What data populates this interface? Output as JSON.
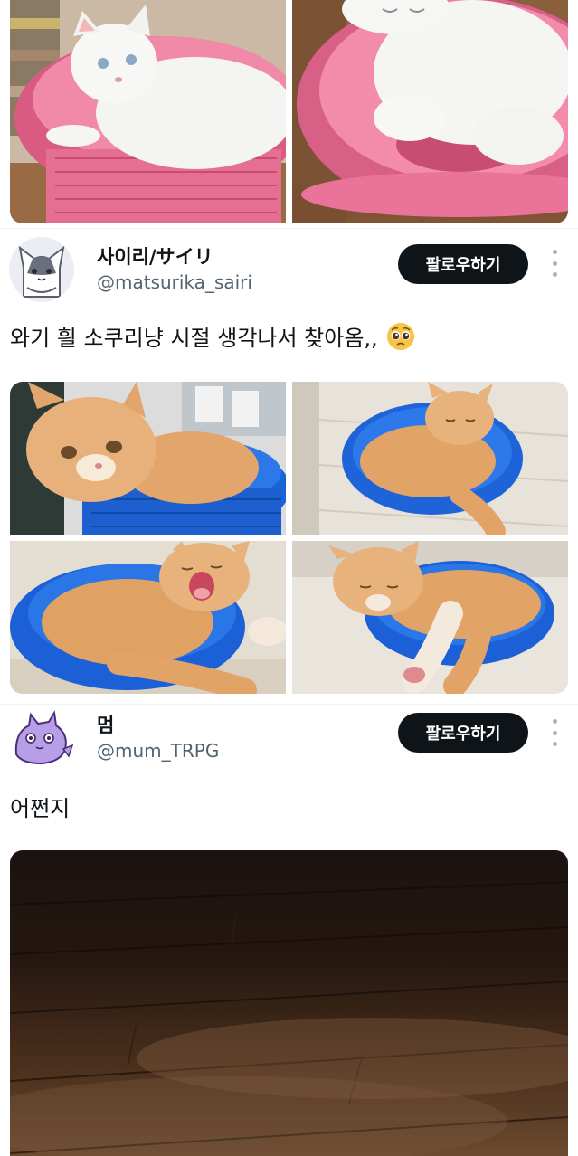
{
  "posts": [
    {
      "author": {
        "name": "사이리/サイリ",
        "handle": "@matsurika_sairi"
      },
      "follow_label": "팔로우하기",
      "text": "와기 흴 소쿠리냥 시절 생각나서 찾아옴,,",
      "emoji": "pleading-face-icon"
    },
    {
      "author": {
        "name": "멈",
        "handle": "@mum_TRPG"
      },
      "follow_label": "팔로우하기",
      "text": "어쩐지"
    }
  ],
  "colors": {
    "follow_button_bg": "#0f1419",
    "handle_text": "#536471",
    "pink_basket": "#e8799a",
    "blue_basket": "#1f5fd6",
    "orange_cat": "#e0a063"
  }
}
